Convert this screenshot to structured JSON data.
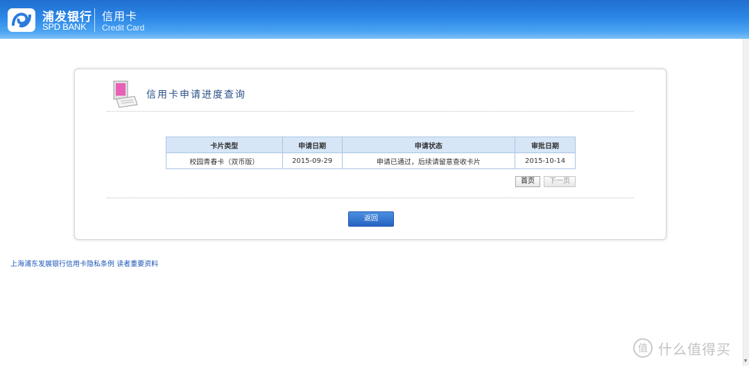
{
  "header": {
    "brand_cn": "浦发银行",
    "brand_en": "SPD BANK",
    "product_cn": "信用卡",
    "product_en": "Credit Card",
    "logo_icon": "spd-bank-logo-icon"
  },
  "panel": {
    "title": "信用卡申请进度查询",
    "icon": "computer-screen-icon"
  },
  "table": {
    "columns": [
      "卡片类型",
      "申请日期",
      "申请状态",
      "审批日期"
    ],
    "rows": [
      [
        "校园青春卡（双币版）",
        "2015-09-29",
        "申请已通过，后续请留意查收卡片",
        "2015-10-14"
      ]
    ]
  },
  "pager": {
    "first_label": "首页",
    "next_label": "下一页"
  },
  "actions": {
    "return_label": "返回"
  },
  "footer": {
    "link_text": "上海浦东发展银行信用卡隐私条例 读者重要资料"
  },
  "watermark": {
    "glyph": "值",
    "text": "什么值得买"
  },
  "colors": {
    "header_top": "#1f6fd0",
    "header_bottom": "#7cc0f7",
    "table_header_bg": "#d7e6f7",
    "table_border": "#a9c4e3",
    "link": "#1b56b8",
    "button_primary": "#2463c2"
  }
}
